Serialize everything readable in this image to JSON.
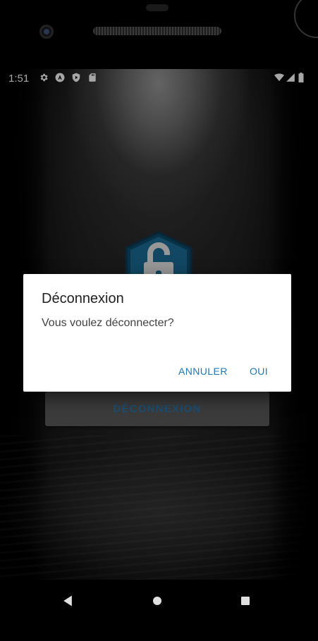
{
  "status_bar": {
    "time": "1:51",
    "left_icons": [
      "settings-icon",
      "app-a-icon",
      "shield-play-icon",
      "sd-card-icon"
    ],
    "right_icons": [
      "wifi-icon",
      "signal-icon",
      "battery-icon"
    ]
  },
  "background": {
    "logo_icon": "padlock-open-icon",
    "logout_button_label": "DÉCONNEXION",
    "accent_color": "#2b78b0"
  },
  "dialog": {
    "title": "Déconnexion",
    "message": "Vous voulez déconnecter?",
    "cancel_label": "ANNULER",
    "ok_label": "OUI",
    "button_color": "#1f78b4"
  },
  "nav_bar": {
    "items": [
      "back-icon",
      "home-icon",
      "recents-icon"
    ]
  }
}
